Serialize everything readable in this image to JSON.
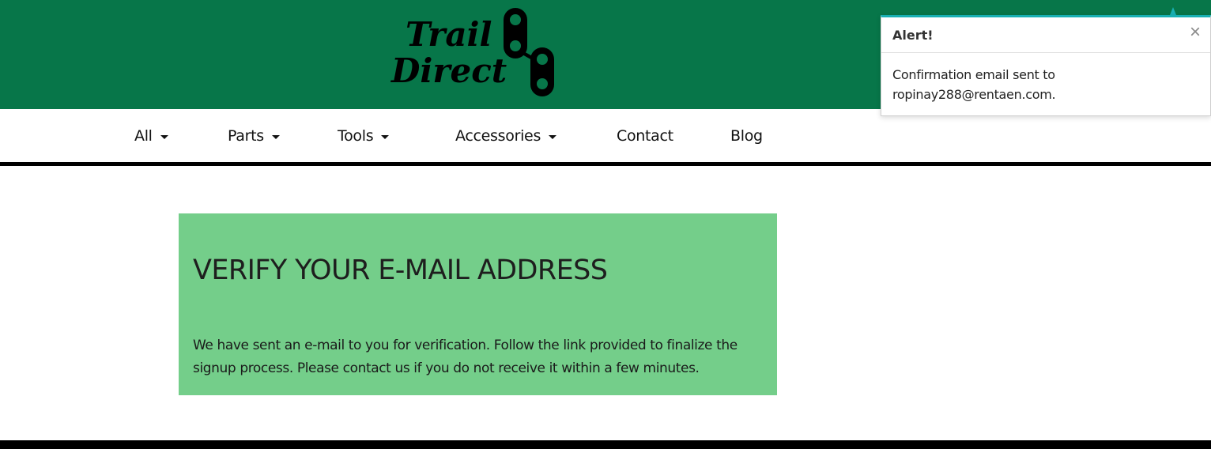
{
  "logo": {
    "line1": "Trail",
    "line2": "Direct"
  },
  "nav": {
    "items": [
      {
        "label": "All",
        "dropdown": true
      },
      {
        "label": "Parts",
        "dropdown": true
      },
      {
        "label": "Tools",
        "dropdown": true
      },
      {
        "label": "Accessories",
        "dropdown": true
      },
      {
        "label": "Contact",
        "dropdown": false
      },
      {
        "label": "Blog",
        "dropdown": false
      }
    ]
  },
  "verify": {
    "title": "VERIFY YOUR E-MAIL ADDRESS",
    "message": "We have sent an e-mail to you for verification. Follow the link provided to finalize the signup process. Please contact us if you do not receive it within a few minutes."
  },
  "alert": {
    "title": "Alert!",
    "close_label": "×",
    "message": "Confirmation email sent to ropinay288@rentaen.com."
  },
  "colors": {
    "header_bg": "#077649",
    "card_bg": "#74ce8a",
    "alert_accent": "#18b0b3"
  },
  "icons": [
    "chain-link-icon",
    "caret-down-icon",
    "close-icon"
  ]
}
